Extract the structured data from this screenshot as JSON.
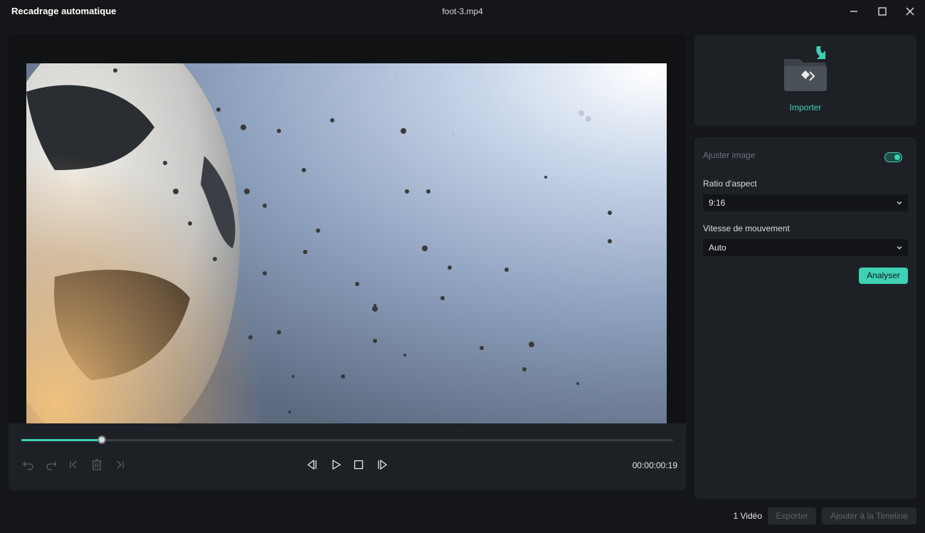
{
  "window": {
    "title": "Recadrage automatique",
    "file_name": "foot-3.mp4",
    "controls": [
      "minimize-icon",
      "maximize-icon",
      "close-icon"
    ]
  },
  "player": {
    "progress": 0.123,
    "timecode": "00:00:00:19",
    "edit_icons": [
      "undo-icon",
      "redo-icon",
      "jump-start-icon",
      "trash-icon",
      "jump-end-icon"
    ],
    "transport_icons": [
      "previous-frame-icon",
      "play-icon",
      "stop-icon",
      "next-frame-icon"
    ]
  },
  "import": {
    "label": "Importer",
    "icon": "folder-import-icon"
  },
  "settings": {
    "adjust_label": "Ajuster image",
    "adjust_enabled": true,
    "aspect_label": "Ratio d'aspect",
    "aspect_value": "9:16",
    "speed_label": "Vitesse de mouvement",
    "speed_value": "Auto",
    "analyze_label": "Analyser"
  },
  "footer": {
    "video_count": "1 Vidéo",
    "export_label": "Exporter",
    "add_timeline_label": "Ajouter à la Timeline"
  },
  "colors": {
    "accent": "#3fd1b4",
    "background": "#141619",
    "panel": "#1d2126"
  }
}
